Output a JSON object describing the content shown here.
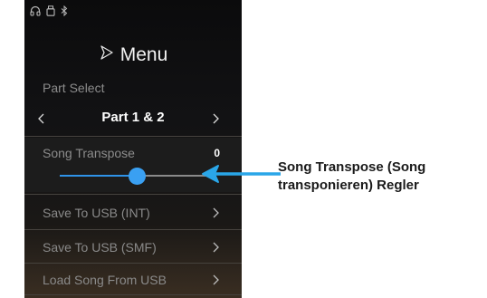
{
  "status_icons": [
    "headphones-icon",
    "usb-drive-icon",
    "bluetooth-icon"
  ],
  "menu": {
    "title": "Menu",
    "icon": "play-outline-icon"
  },
  "part_select": {
    "label": "Part Select",
    "value": "Part 1 & 2"
  },
  "song_transpose": {
    "label": "Song Transpose",
    "value": "0",
    "slider_level": 0.5
  },
  "items": [
    {
      "label": "Save To USB (INT)"
    },
    {
      "label": "Save To USB (SMF)"
    },
    {
      "label": "Load Song From USB"
    }
  ],
  "callout": {
    "text": "Song Transpose (Song transponieren) Regler"
  },
  "colors": {
    "accent": "#3aa0f2",
    "callout_arrow": "#2aa6e8",
    "screen_bg": "#121214"
  }
}
